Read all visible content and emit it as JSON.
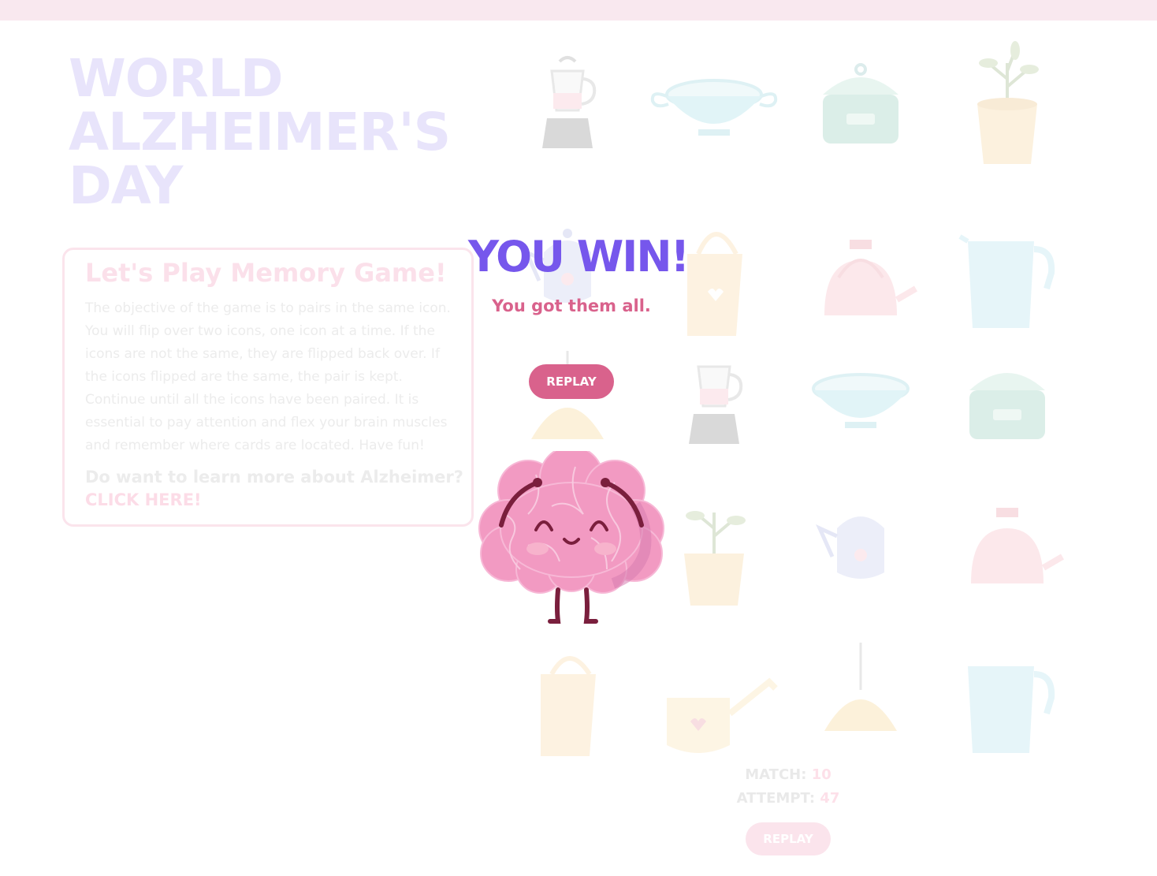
{
  "page": {
    "title_lines": [
      "WORLD",
      "ALZHEIMER'S",
      "DAY"
    ]
  },
  "info": {
    "heading": "Let's Play Memory Game!",
    "description": "The objective of the game is to pairs in the same icon. You will flip over two icons, one icon at a time. If the icons are not the same, they are flipped back over. If the icons flipped are the same, the pair is kept. Continue until all the icons have been paired. It is essential to pay attention and flex your brain muscles and remember where cards are located. Have fun!",
    "question": "Do want to learn more about Alzheimer?",
    "link": "CLICK HERE!"
  },
  "board": {
    "cards": [
      {
        "icon": "blender-icon"
      },
      {
        "icon": "tureen-icon"
      },
      {
        "icon": "cooking-pot-icon"
      },
      {
        "icon": "potted-plant-icon"
      },
      {
        "icon": "coffee-pot-icon"
      },
      {
        "icon": "tote-bag-icon"
      },
      {
        "icon": "kettle-icon"
      },
      {
        "icon": "pitcher-icon"
      },
      {
        "icon": "pendant-lamp-icon"
      },
      {
        "icon": "blender-icon"
      },
      {
        "icon": "tureen-icon"
      },
      {
        "icon": "cooking-pot-icon"
      },
      {
        "icon": "empty"
      },
      {
        "icon": "potted-plant-icon"
      },
      {
        "icon": "coffee-pot-icon"
      },
      {
        "icon": "kettle-icon"
      },
      {
        "icon": "tote-bag-icon"
      },
      {
        "icon": "watering-can-icon"
      },
      {
        "icon": "pendant-lamp-icon"
      },
      {
        "icon": "pitcher-icon"
      }
    ]
  },
  "stats": {
    "match_label": "MATCH:",
    "match_value": "10",
    "attempt_label": "ATTEMPT:",
    "attempt_value": "47",
    "replay_label": "REPLAY"
  },
  "win": {
    "title": "YOU WIN!",
    "subtitle": "You got them all.",
    "replay_label": "REPLAY",
    "mascot": "happy-brain-icon"
  },
  "colors": {
    "accent_purple": "#7657ec",
    "accent_pink": "#d9628c",
    "brain_pink": "#f29ac2",
    "faded_title": "#e8e4fb",
    "topbar": "#f9e8ef"
  }
}
